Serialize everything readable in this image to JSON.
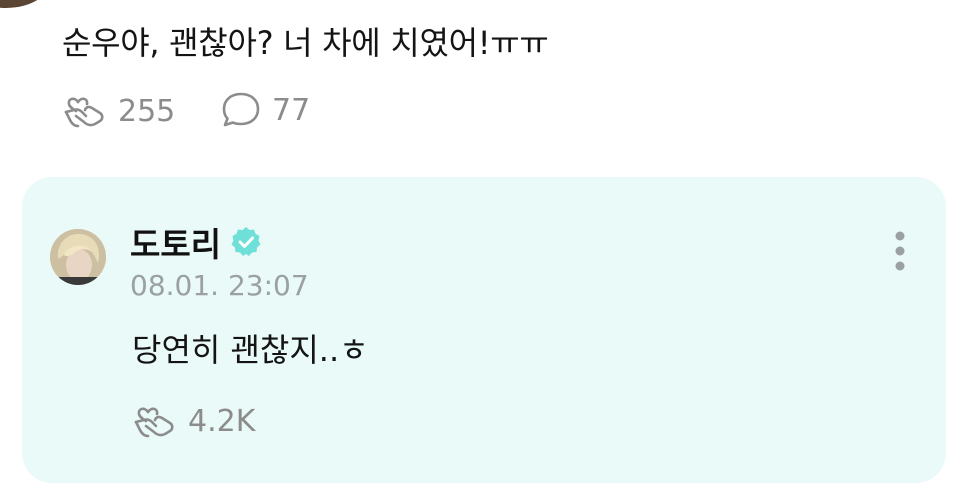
{
  "post": {
    "text": "순우야, 괜찮아? 너 차에 치였어!ㅠㅠ",
    "likes": "255",
    "comments": "77",
    "like_icon": "heart-hand-icon",
    "comment_icon": "speech-bubble-icon"
  },
  "reply": {
    "username": "도토리",
    "timestamp": "08.01. 23:07",
    "text": "당연히 괜찮지..ㅎ",
    "likes": "4.2K",
    "verified_icon": "verified-badge-icon",
    "more_icon": "kebab-menu-icon"
  },
  "colors": {
    "reply_background": "#eafaf8",
    "verified": "#6fe0d8",
    "muted_text": "#8c8c8c",
    "timestamp": "#9aa0a3",
    "body_text": "#141414"
  }
}
